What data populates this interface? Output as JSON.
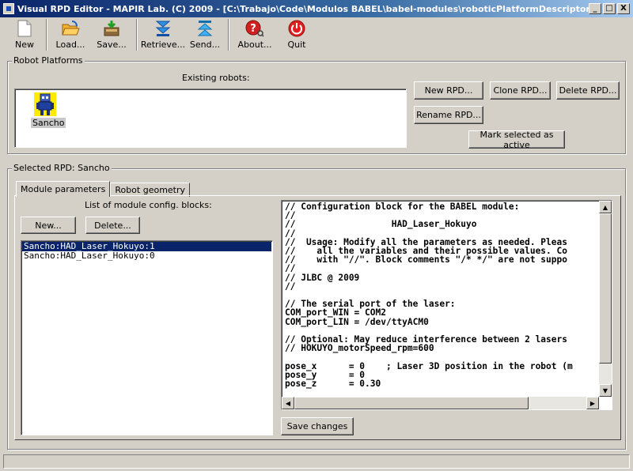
{
  "window": {
    "title": "Visual RPD Editor - MAPIR Lab. (C) 2009 - [C:\\Trabajo\\Code\\Modulos BABEL\\babel-modules\\roboticPlatformDescriptors.xml]",
    "minimize": "_",
    "maximize": "□",
    "close": "X"
  },
  "toolbar": [
    {
      "label": "New",
      "icon": "new-file-icon"
    },
    {
      "label": "Load...",
      "icon": "load-icon"
    },
    {
      "label": "Save...",
      "icon": "save-icon"
    },
    {
      "label": "Retrieve...",
      "icon": "retrieve-icon"
    },
    {
      "label": "Send...",
      "icon": "send-icon"
    },
    {
      "label": "About...",
      "icon": "about-icon"
    },
    {
      "label": "Quit",
      "icon": "quit-icon"
    }
  ],
  "robot_platforms": {
    "group_title": "Robot Platforms",
    "list_label": "Existing robots:",
    "robots": [
      {
        "name": "Sancho",
        "icon": "robot-icon"
      }
    ],
    "buttons": {
      "new_rpd": "New RPD...",
      "clone_rpd": "Clone RPD...",
      "delete_rpd": "Delete RPD...",
      "rename_rpd": "Rename RPD...",
      "mark_active": "Mark selected as active"
    }
  },
  "selected_rpd": {
    "group_title": "Selected RPD: Sancho",
    "tabs": [
      "Module parameters",
      "Robot geometry"
    ],
    "active_tab": "Module parameters",
    "blocks_label": "List of module config. blocks:",
    "new_button": "New...",
    "delete_button": "Delete...",
    "blocks": [
      {
        "name": "Sancho:HAD_Laser_Hokuyo:1",
        "selected": true
      },
      {
        "name": "Sancho:HAD_Laser_Hokuyo:0",
        "selected": false
      }
    ],
    "editor_text": "// Configuration block for the BABEL module:\n//\n//                  HAD_Laser_Hokuyo\n//\n//  Usage: Modify all the parameters as needed. Pleas\n//    all the variables and their possible values. Co\n//    with \"//\". Block comments \"/* */\" are not suppo\n//\n// JLBC @ 2009\n//\n\n// The serial port of the laser:\nCOM_port_WIN = COM2\nCOM_port_LIN = /dev/ttyACM0\n\n// Optional: May reduce interference between 2 lasers\n// HOKUYO_motorSpeed_rpm=600\n\npose_x      = 0    ; Laser 3D position in the robot (m\npose_y      = 0\npose_z      = 0.30",
    "save_button": "Save changes"
  },
  "colors": {
    "face": "#d4d0c8",
    "title_start": "#0a246a",
    "title_end": "#a6caf0",
    "selection": "#0a246a"
  }
}
